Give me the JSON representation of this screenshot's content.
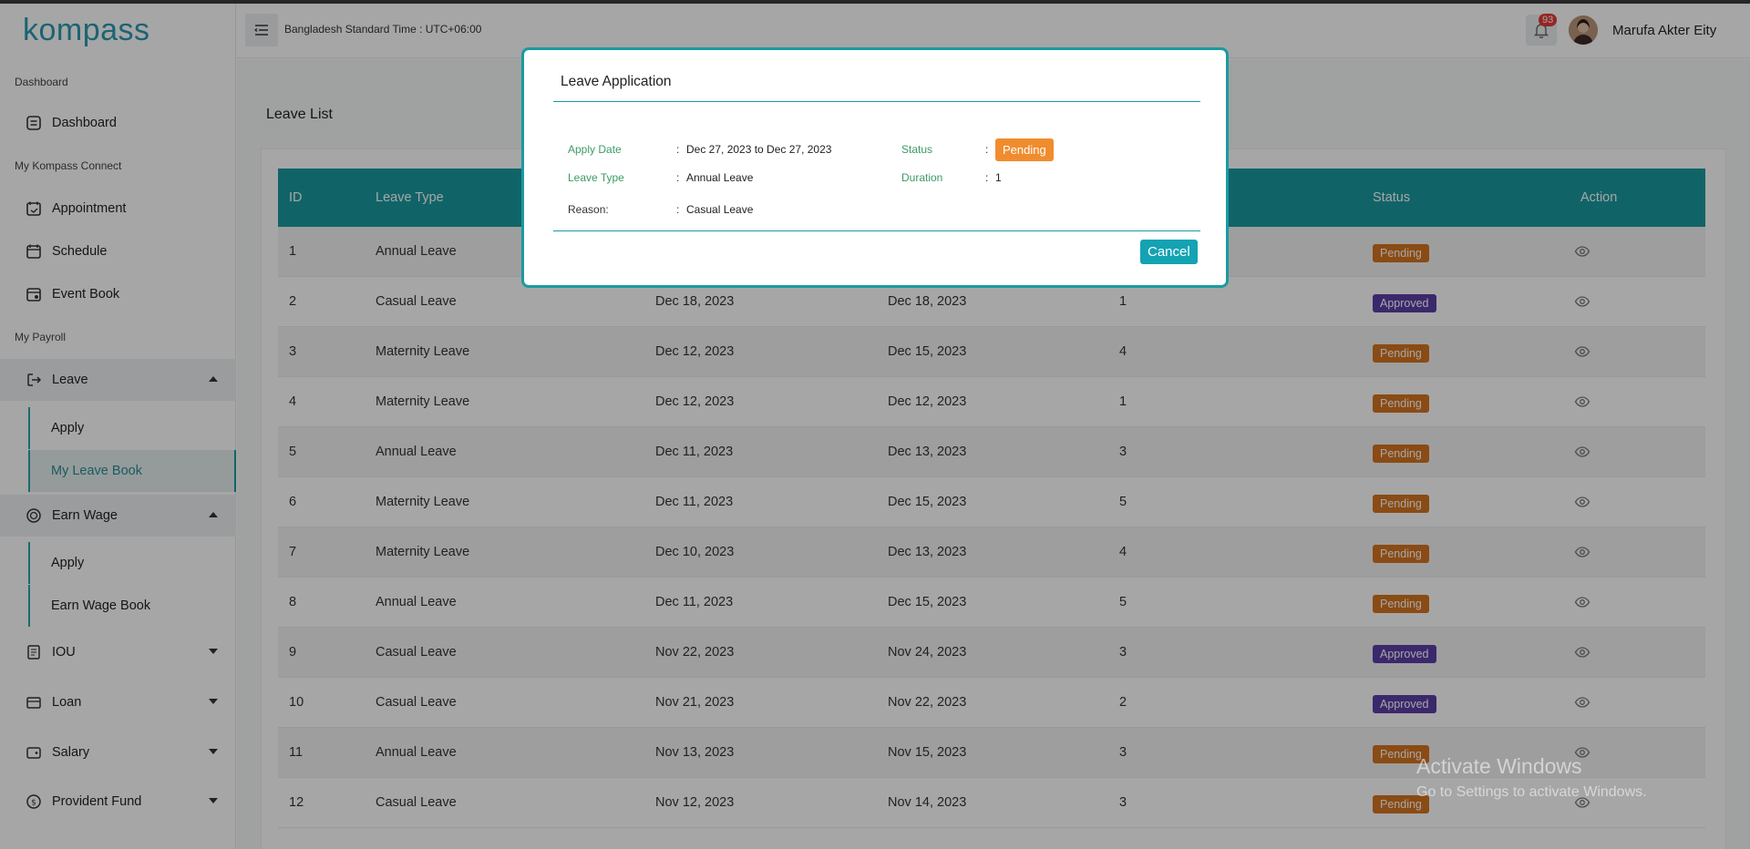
{
  "app": {
    "logo": "kompass"
  },
  "header": {
    "timezone": "Bangladesh Standard Time : UTC+06:00",
    "notification_count": "93",
    "user_name": "Marufa Akter Eity"
  },
  "sidebar": {
    "sections": [
      "Dashboard",
      "My Kompass Connect",
      "My Payroll"
    ],
    "items": {
      "dashboard": "Dashboard",
      "appointment": "Appointment",
      "schedule": "Schedule",
      "event_book": "Event Book",
      "leave": "Leave",
      "leave_apply": "Apply",
      "my_leave_book": "My Leave Book",
      "earn_wage": "Earn Wage",
      "earn_wage_apply": "Apply",
      "earn_wage_book": "Earn Wage Book",
      "iou": "IOU",
      "loan": "Loan",
      "salary": "Salary",
      "provident_fund": "Provident Fund"
    }
  },
  "page": {
    "title": "Leave List"
  },
  "table": {
    "headers": {
      "id": "ID",
      "leave_type": "Leave Type",
      "status": "Status",
      "action": "Action"
    },
    "rows": [
      {
        "id": "1",
        "type": "Annual Leave",
        "from": "",
        "to": "",
        "days": "",
        "status": "Pending"
      },
      {
        "id": "2",
        "type": "Casual Leave",
        "from": "Dec 18, 2023",
        "to": "Dec 18, 2023",
        "days": "1",
        "status": "Approved"
      },
      {
        "id": "3",
        "type": "Maternity Leave",
        "from": "Dec 12, 2023",
        "to": "Dec 15, 2023",
        "days": "4",
        "status": "Pending"
      },
      {
        "id": "4",
        "type": "Maternity Leave",
        "from": "Dec 12, 2023",
        "to": "Dec 12, 2023",
        "days": "1",
        "status": "Pending"
      },
      {
        "id": "5",
        "type": "Annual Leave",
        "from": "Dec 11, 2023",
        "to": "Dec 13, 2023",
        "days": "3",
        "status": "Pending"
      },
      {
        "id": "6",
        "type": "Maternity Leave",
        "from": "Dec 11, 2023",
        "to": "Dec 15, 2023",
        "days": "5",
        "status": "Pending"
      },
      {
        "id": "7",
        "type": "Maternity Leave",
        "from": "Dec 10, 2023",
        "to": "Dec 13, 2023",
        "days": "4",
        "status": "Pending"
      },
      {
        "id": "8",
        "type": "Annual Leave",
        "from": "Dec 11, 2023",
        "to": "Dec 15, 2023",
        "days": "5",
        "status": "Pending"
      },
      {
        "id": "9",
        "type": "Casual Leave",
        "from": "Nov 22, 2023",
        "to": "Nov 24, 2023",
        "days": "3",
        "status": "Approved"
      },
      {
        "id": "10",
        "type": "Casual Leave",
        "from": "Nov 21, 2023",
        "to": "Nov 22, 2023",
        "days": "2",
        "status": "Approved"
      },
      {
        "id": "11",
        "type": "Annual Leave",
        "from": "Nov 13, 2023",
        "to": "Nov 15, 2023",
        "days": "3",
        "status": "Pending"
      },
      {
        "id": "12",
        "type": "Casual Leave",
        "from": "Nov 12, 2023",
        "to": "Nov 14, 2023",
        "days": "3",
        "status": "Pending"
      }
    ]
  },
  "modal": {
    "title": "Leave Application",
    "apply_date_label": "Apply Date",
    "apply_date_value": "Dec 27, 2023 to Dec 27, 2023",
    "leave_type_label": "Leave Type",
    "leave_type_value": "Annual Leave",
    "reason_label": "Reason:",
    "reason_value": "Casual Leave",
    "status_label": "Status",
    "status_value": "Pending",
    "duration_label": "Duration",
    "duration_value": "1",
    "colon": ":",
    "cancel_label": "Cancel"
  },
  "watermark": {
    "line1": "Activate Windows",
    "line2": "Go to Settings to activate Windows."
  },
  "colors": {
    "accent": "#1a9aa0",
    "pending": "#d5741f",
    "approved": "#5b3ea7",
    "modal_pending": "#f08c2e"
  }
}
